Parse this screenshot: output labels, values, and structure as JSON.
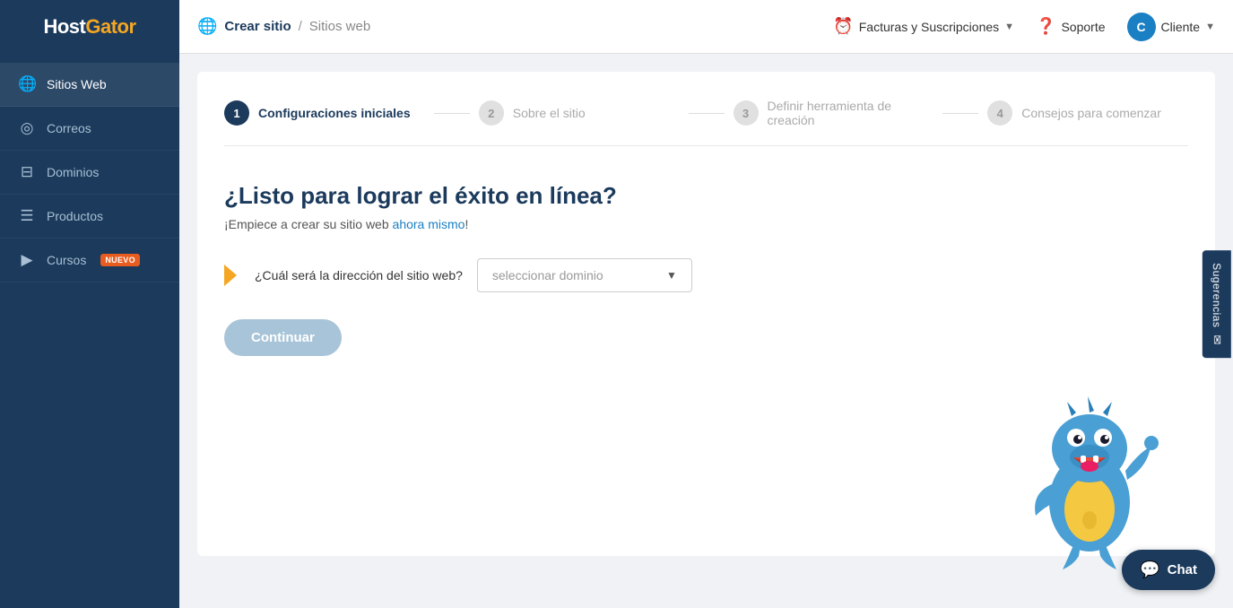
{
  "header": {
    "logo": {
      "host": "Host",
      "gator": "Gator"
    },
    "breadcrumb": {
      "globe_icon": "🌐",
      "current": "Crear sitio",
      "separator": "/",
      "parent": "Sitios web"
    },
    "billing_label": "Facturas y Suscripciones",
    "support_label": "Soporte",
    "client_label": "Cliente",
    "client_initial": "C"
  },
  "sidebar": {
    "items": [
      {
        "label": "Sitios Web",
        "icon": "🌐",
        "active": true
      },
      {
        "label": "Correos",
        "icon": "◎",
        "active": false
      },
      {
        "label": "Dominios",
        "icon": "⊟",
        "active": false
      },
      {
        "label": "Productos",
        "icon": "☰",
        "active": false
      },
      {
        "label": "Cursos",
        "icon": "▶",
        "active": false,
        "badge": "NUEVO"
      }
    ]
  },
  "steps": [
    {
      "number": "1",
      "label": "Configuraciones iniciales",
      "active": true
    },
    {
      "number": "2",
      "label": "Sobre el sitio",
      "active": false
    },
    {
      "number": "3",
      "label": "Definir herramienta de creación",
      "active": false
    },
    {
      "number": "4",
      "label": "Consejos para comenzar",
      "active": false
    }
  ],
  "content": {
    "title": "¿Listo para lograr el éxito en línea?",
    "subtitle_prefix": "¡Empiece a crear su sitio web ",
    "subtitle_highlight": "ahora mismo",
    "subtitle_suffix": "!",
    "domain_question": "¿Cuál será la dirección del sitio web?",
    "domain_placeholder": "seleccionar dominio",
    "continue_label": "Continuar"
  },
  "chat": {
    "label": "Chat"
  },
  "sugerencias": {
    "label": "Sugerencias"
  }
}
